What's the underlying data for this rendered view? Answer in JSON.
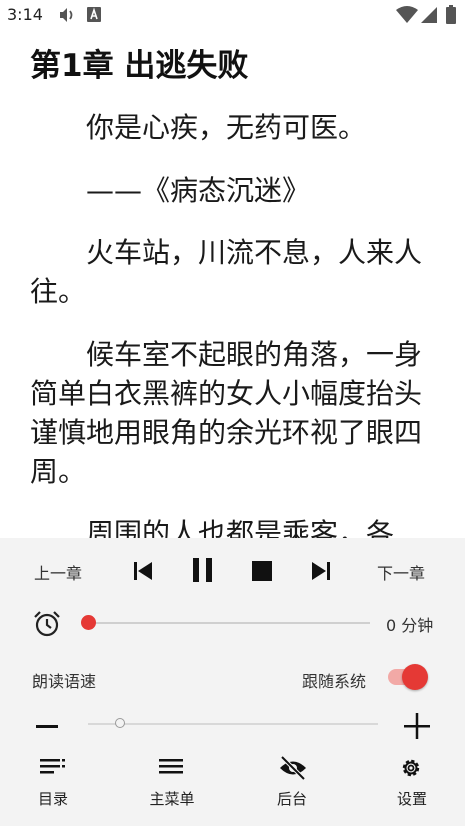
{
  "status_bar": {
    "time": "3:14",
    "icons": [
      "volume-icon",
      "keyboard-a-icon",
      "wifi-icon",
      "signal-icon",
      "battery-icon"
    ]
  },
  "reader": {
    "chapter_title": "第1章 出逃失败",
    "paragraphs": [
      "　　你是心疾，无药可医。",
      "　　——《病态沉迷》",
      "　　火车站，川流不息，人来人往。",
      "　　候车室不起眼的角落，一身简单白衣黑裤的女人小幅度抬头谨慎地用眼角的余光环视了眼四周。",
      "　　周围的人也都是乘客，各"
    ]
  },
  "tts_panel": {
    "prev_chapter": "上一章",
    "next_chapter": "下一章",
    "controls": [
      "skip-previous-icon",
      "pause-icon",
      "stop-icon",
      "skip-next-icon"
    ],
    "timer": {
      "value": "0 分钟",
      "progress": 0
    },
    "speed": {
      "label": "朗读语速",
      "follow_system_label": "跟随系统",
      "follow_system": true,
      "minus": "−",
      "plus": "+",
      "level": 0.1
    },
    "accent": "#e53935"
  },
  "bottom_nav": [
    {
      "label": "目录",
      "icon": "toc-icon"
    },
    {
      "label": "主菜单",
      "icon": "menu-icon"
    },
    {
      "label": "后台",
      "icon": "eye-off-icon"
    },
    {
      "label": "设置",
      "icon": "gear-icon"
    }
  ]
}
